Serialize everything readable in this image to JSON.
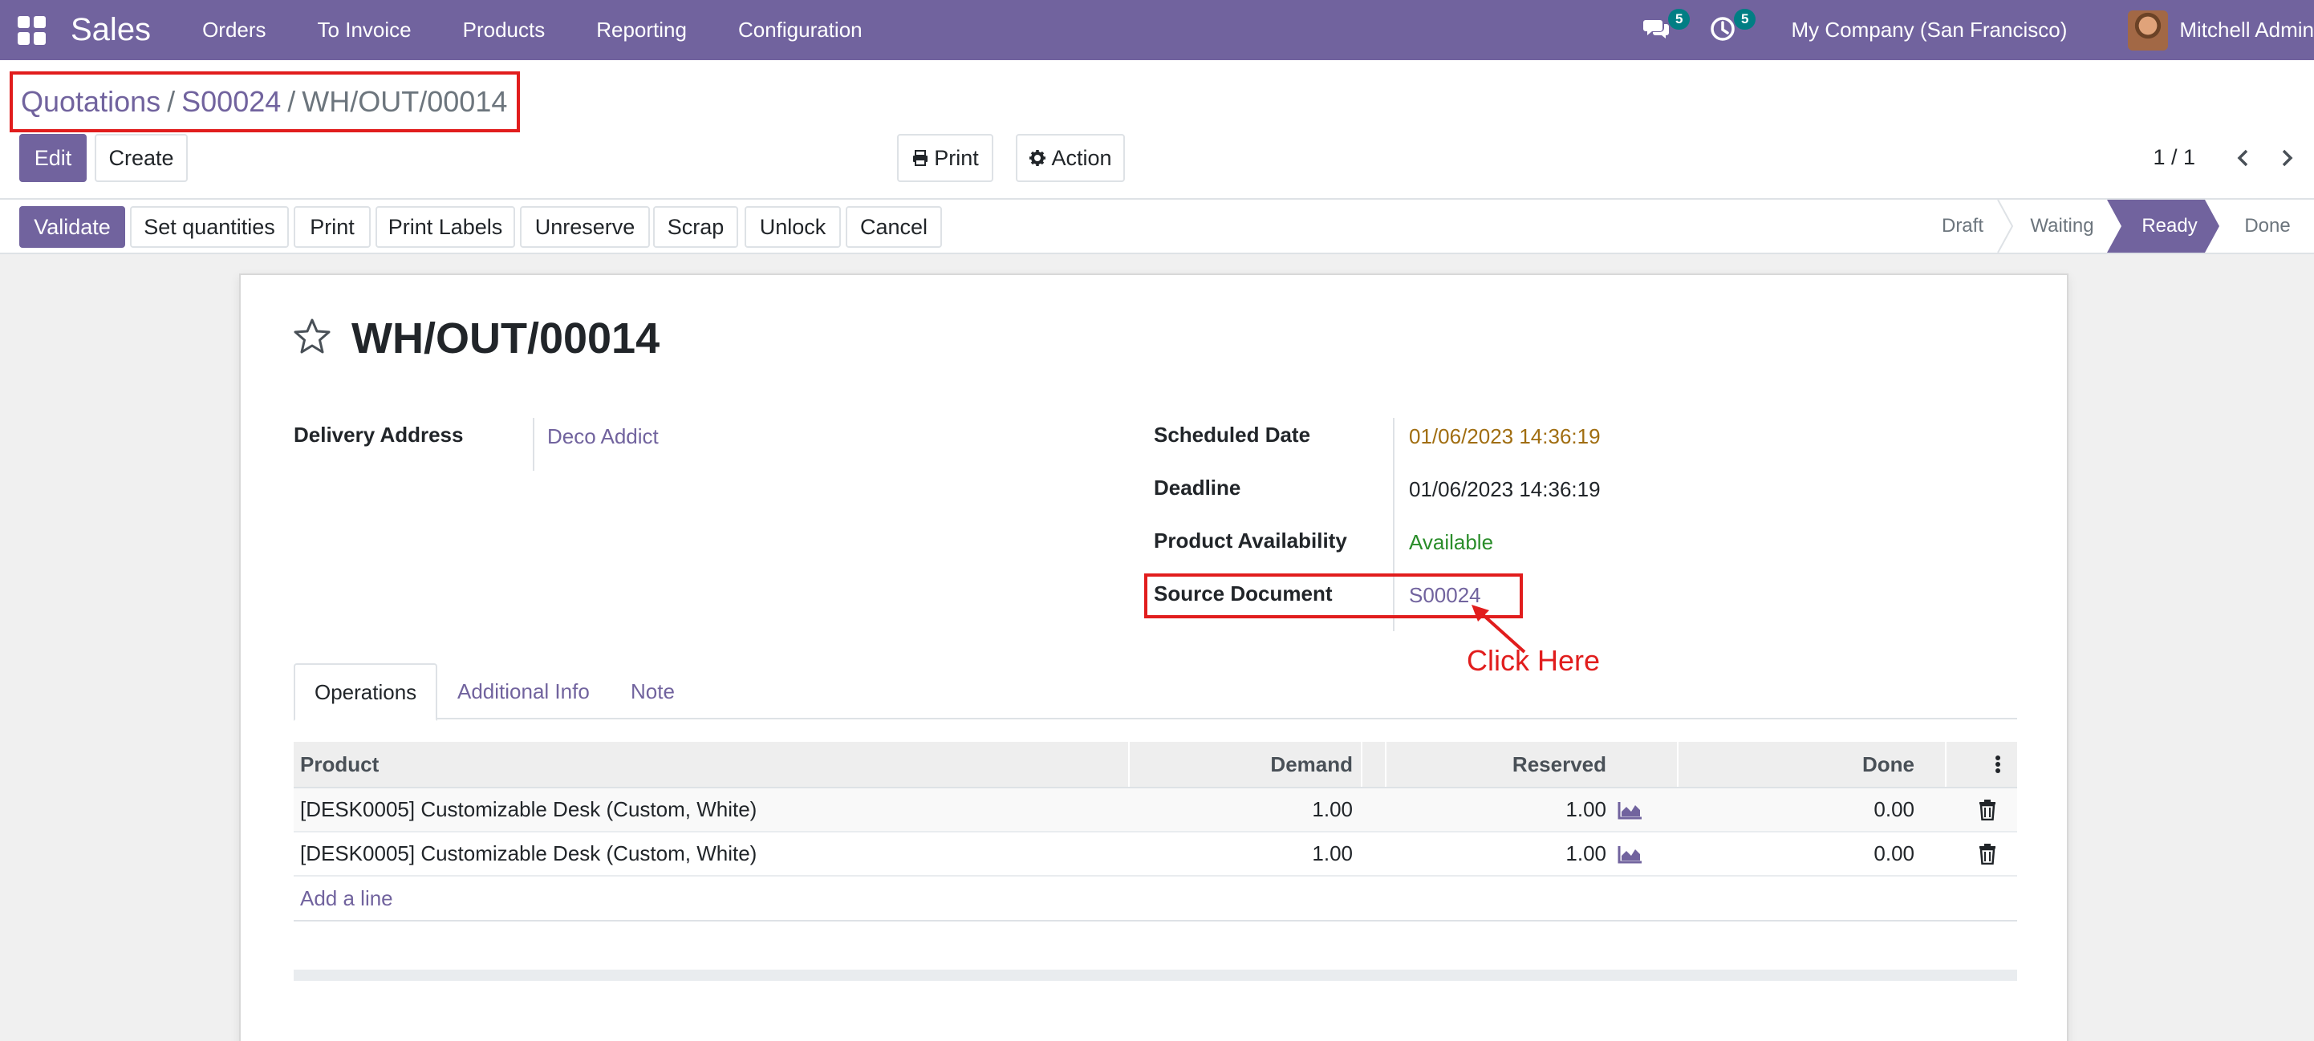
{
  "navbar": {
    "app_name": "Sales",
    "menu": [
      "Orders",
      "To Invoice",
      "Products",
      "Reporting",
      "Configuration"
    ],
    "messages_count": "5",
    "activities_count": "5",
    "company": "My Company (San Francisco)",
    "user": "Mitchell Admin",
    "accent_color": "#71639e"
  },
  "breadcrumb": {
    "items": [
      "Quotations",
      "S00024"
    ],
    "current": "WH/OUT/00014",
    "separator": "/"
  },
  "control": {
    "edit_label": "Edit",
    "create_label": "Create",
    "print_label": "Print",
    "action_label": "Action",
    "pager": "1 / 1"
  },
  "statusbar": {
    "buttons": [
      "Validate",
      "Set quantities",
      "Print",
      "Print Labels",
      "Unreserve",
      "Scrap",
      "Unlock",
      "Cancel"
    ],
    "stages": [
      "Draft",
      "Waiting",
      "Ready",
      "Done"
    ],
    "active_stage": "Ready"
  },
  "record": {
    "title": "WH/OUT/00014",
    "delivery_address_label": "Delivery Address",
    "delivery_address_value": "Deco Addict",
    "scheduled_date_label": "Scheduled Date",
    "scheduled_date_value": "01/06/2023 14:36:19",
    "deadline_label": "Deadline",
    "deadline_value": "01/06/2023 14:36:19",
    "availability_label": "Product Availability",
    "availability_value": "Available",
    "source_document_label": "Source Document",
    "source_document_value": "S00024"
  },
  "annotation": {
    "text": "Click Here",
    "color": "#e11d1d"
  },
  "tabs": [
    "Operations",
    "Additional Info",
    "Note"
  ],
  "table": {
    "columns": [
      "Product",
      "Demand",
      "Reserved",
      "Done"
    ],
    "rows": [
      {
        "product": "[DESK0005] Customizable Desk (Custom, White)",
        "demand": "1.00",
        "reserved": "1.00",
        "done": "0.00"
      },
      {
        "product": "[DESK0005] Customizable Desk (Custom, White)",
        "demand": "1.00",
        "reserved": "1.00",
        "done": "0.00"
      }
    ],
    "add_line_label": "Add a line"
  },
  "icons": [
    "apps-grid-icon",
    "chat-icon",
    "clock-icon",
    "print-icon",
    "gear-icon",
    "chevron-left-icon",
    "chevron-right-icon",
    "star-icon",
    "area-chart-icon",
    "trash-icon",
    "kebab-menu-icon"
  ]
}
